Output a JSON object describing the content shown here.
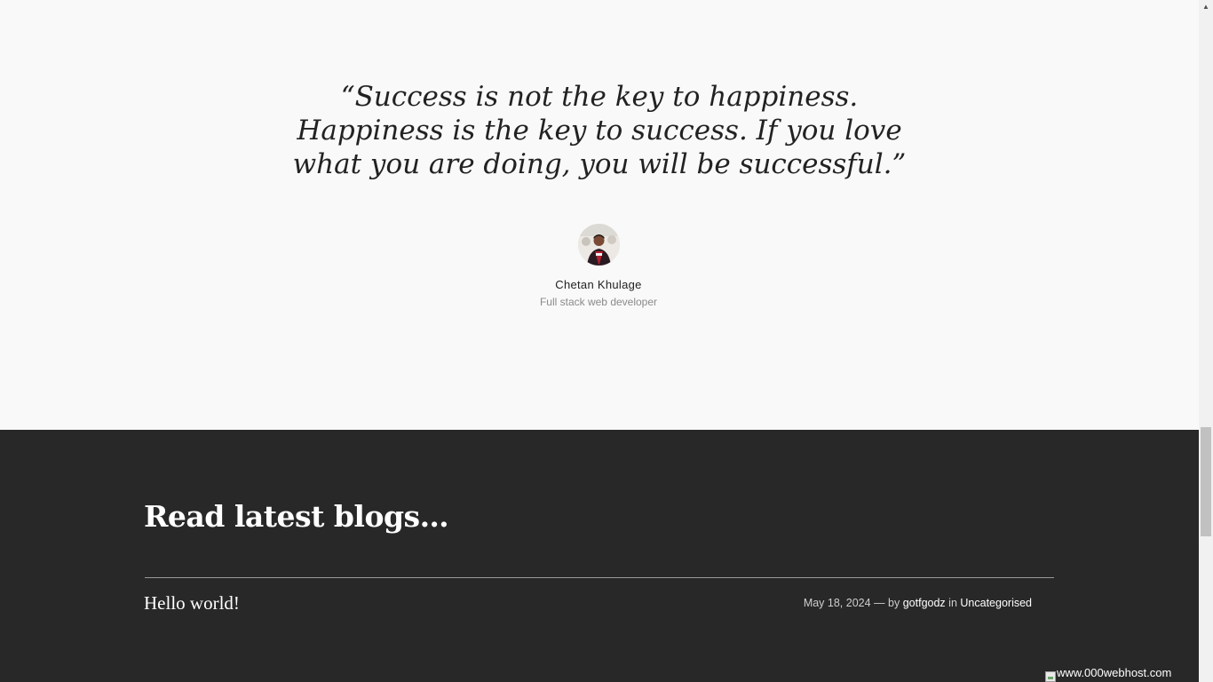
{
  "quote": {
    "text": "“Success is not the key to happiness. Happiness is the key to success. If you love what you are doing, you will be successful.”",
    "author_name": "Chetan Khulage",
    "author_role": "Full stack web developer"
  },
  "blog": {
    "heading": "Read latest blogs…",
    "posts": [
      {
        "title": "Hello world!",
        "date": "May 18, 2024",
        "date_separator": "—",
        "by_label": "by",
        "author": "gotfgodz",
        "in_label": "in",
        "category": "Uncategorised"
      }
    ]
  },
  "host_badge": {
    "text": "www.000webhost.com"
  },
  "colors": {
    "light_bg": "#f9f9f9",
    "dark_bg": "#282828",
    "text_dark": "#222222",
    "text_muted": "#8a8a8a"
  }
}
